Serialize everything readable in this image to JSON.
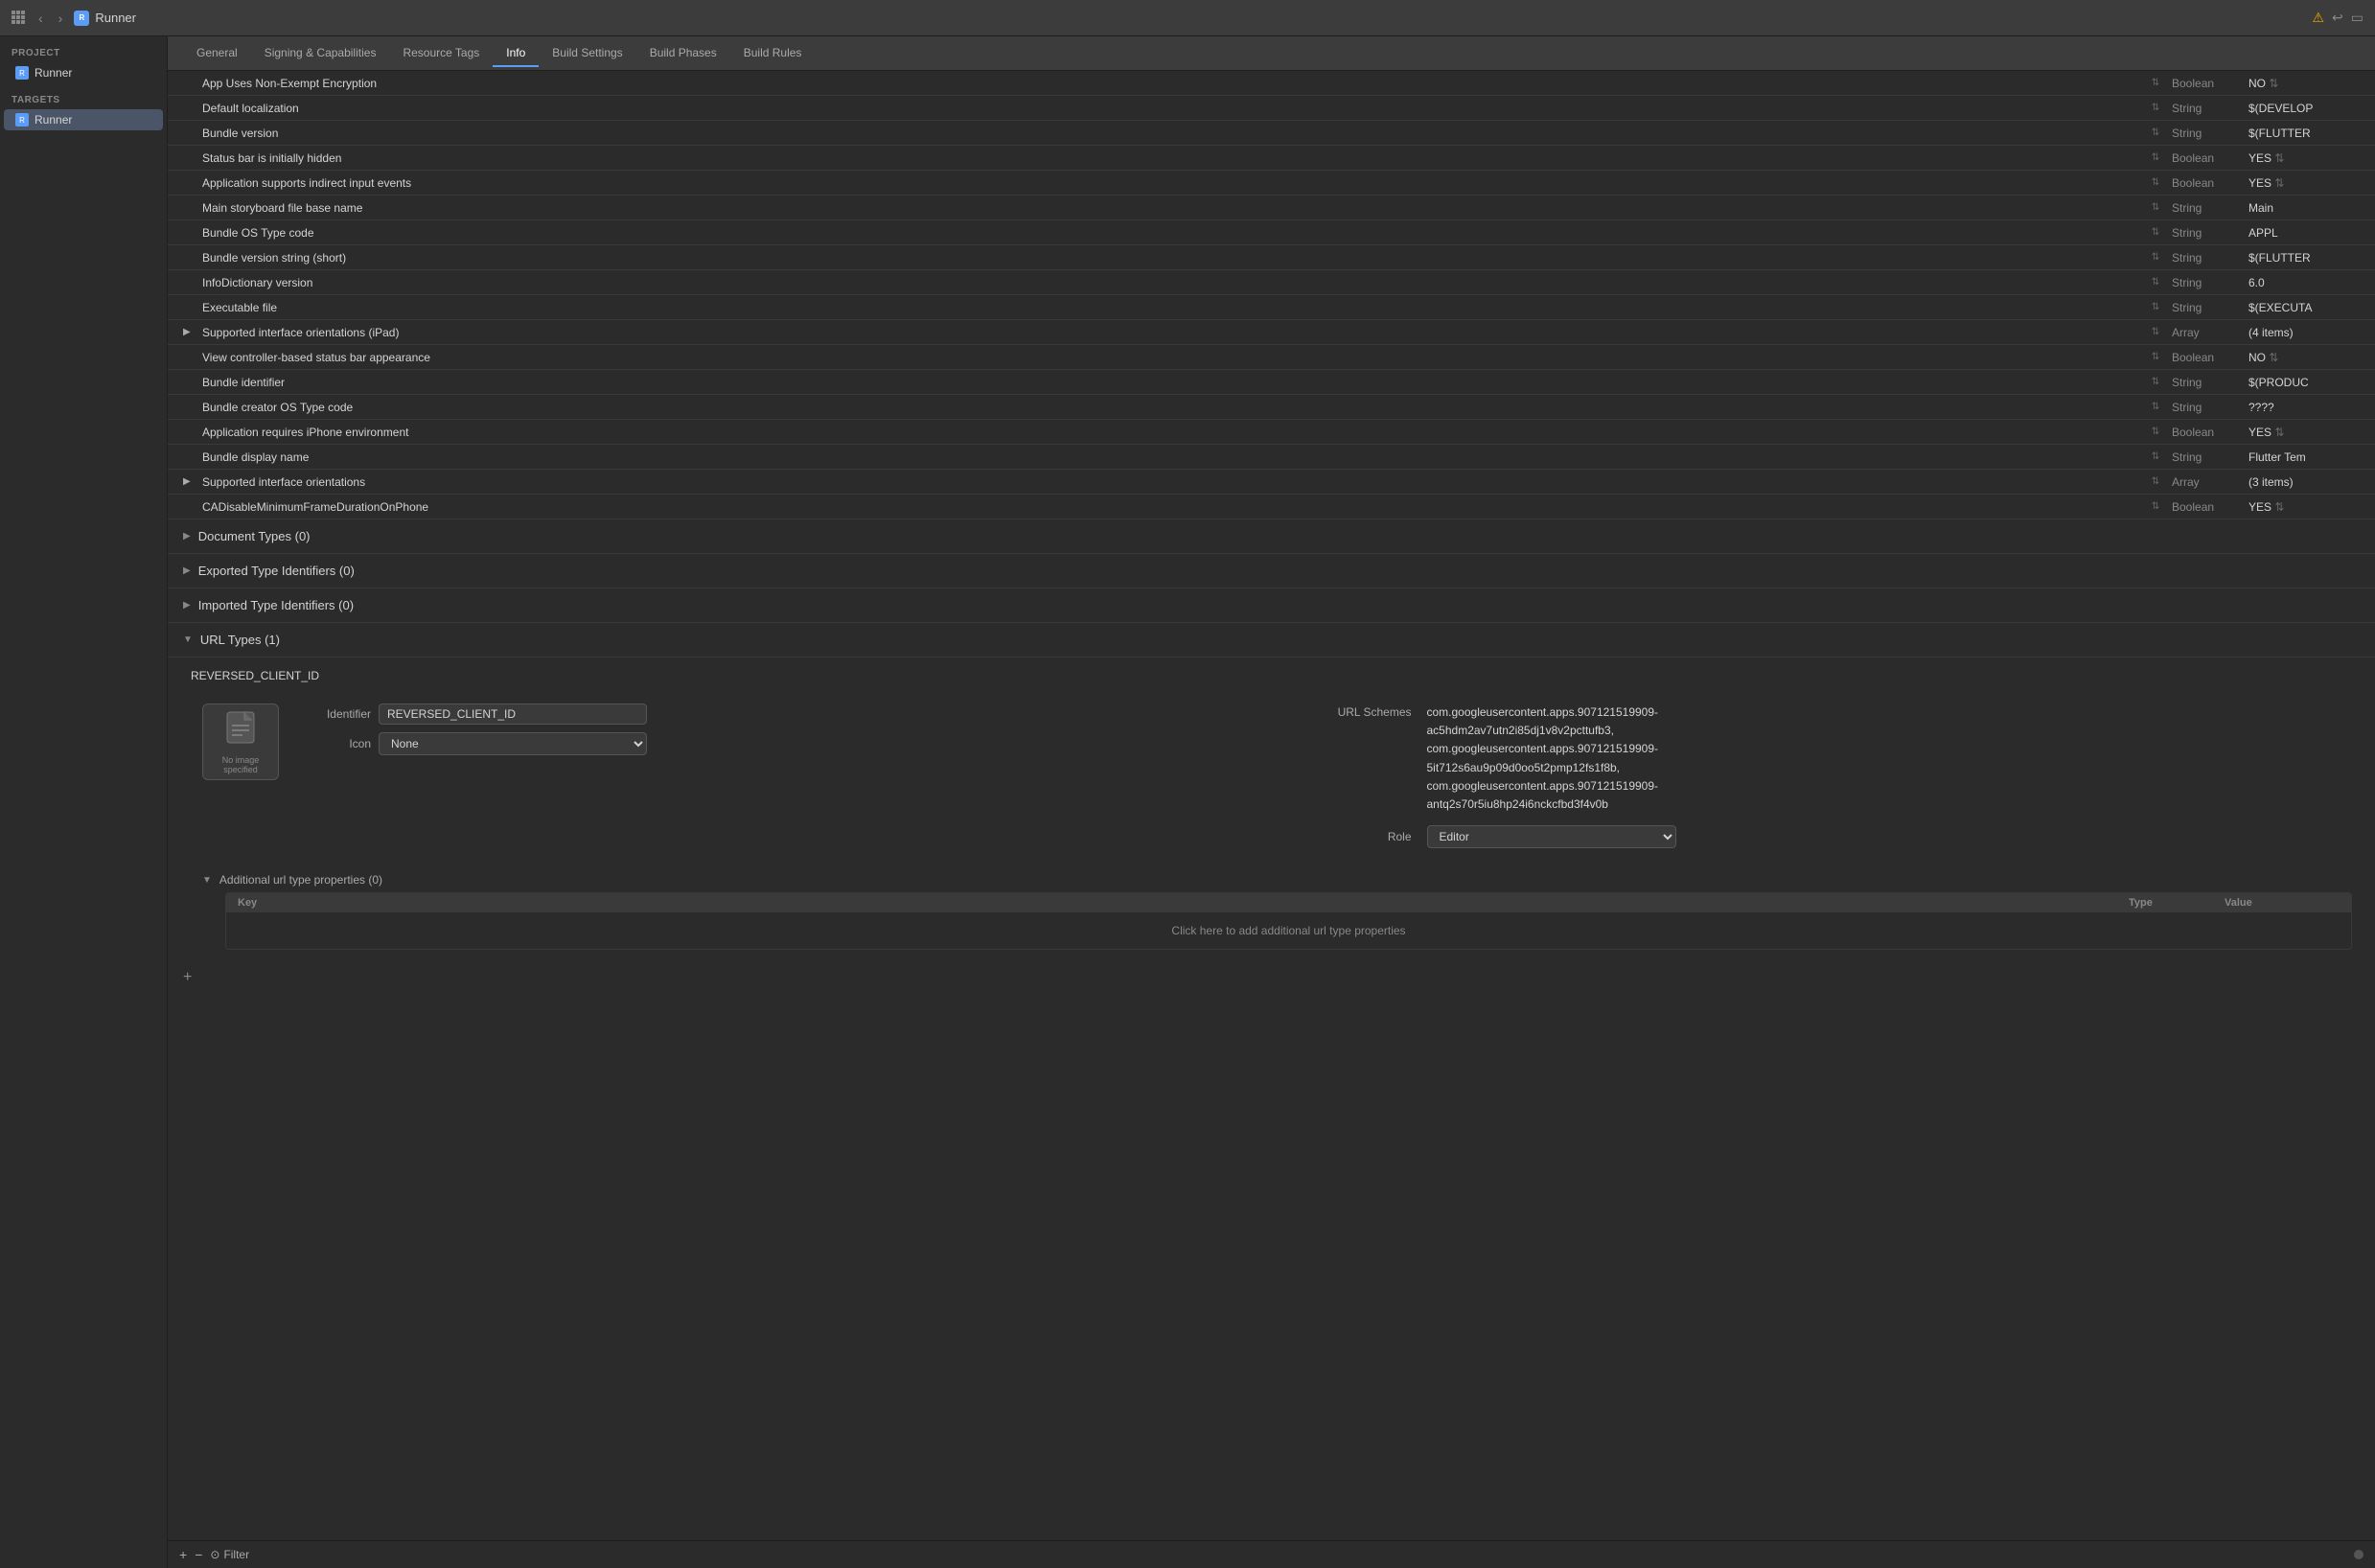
{
  "titleBar": {
    "appName": "Runner",
    "navBack": "‹",
    "navForward": "›"
  },
  "tabs": [
    {
      "label": "General",
      "active": false
    },
    {
      "label": "Signing & Capabilities",
      "active": false
    },
    {
      "label": "Resource Tags",
      "active": false
    },
    {
      "label": "Info",
      "active": true
    },
    {
      "label": "Build Settings",
      "active": false
    },
    {
      "label": "Build Phases",
      "active": false
    },
    {
      "label": "Build Rules",
      "active": false
    }
  ],
  "sidebar": {
    "projectLabel": "PROJECT",
    "projectItem": "Runner",
    "targetsLabel": "TARGETS",
    "targetItem": "Runner"
  },
  "properties": [
    {
      "key": "App Uses Non-Exempt Encryption",
      "type": "Boolean",
      "value": "NO",
      "indent": 0,
      "stepper": true
    },
    {
      "key": "Default localization",
      "type": "String",
      "value": "$(DEVELOP",
      "indent": 0,
      "stepper": true
    },
    {
      "key": "Bundle version",
      "type": "String",
      "value": "$(FLUTTER",
      "indent": 0,
      "stepper": true
    },
    {
      "key": "Status bar is initially hidden",
      "type": "Boolean",
      "value": "YES",
      "indent": 0,
      "stepper": true
    },
    {
      "key": "Application supports indirect input events",
      "type": "Boolean",
      "value": "YES",
      "indent": 0,
      "stepper": true
    },
    {
      "key": "Main storyboard file base name",
      "type": "String",
      "value": "Main",
      "indent": 0,
      "stepper": true
    },
    {
      "key": "Bundle OS Type code",
      "type": "String",
      "value": "APPL",
      "indent": 0,
      "stepper": true
    },
    {
      "key": "Bundle version string (short)",
      "type": "String",
      "value": "$(FLUTTER",
      "indent": 0,
      "stepper": true
    },
    {
      "key": "InfoDictionary version",
      "type": "String",
      "value": "6.0",
      "indent": 0,
      "stepper": true
    },
    {
      "key": "Executable file",
      "type": "String",
      "value": "$(EXECUTA",
      "indent": 0,
      "stepper": true
    },
    {
      "key": "Supported interface orientations (iPad)",
      "type": "Array",
      "value": "(4 items)",
      "indent": 0,
      "stepper": true,
      "expandable": true
    },
    {
      "key": "View controller-based status bar appearance",
      "type": "Boolean",
      "value": "NO",
      "indent": 0,
      "stepper": true
    },
    {
      "key": "Bundle identifier",
      "type": "String",
      "value": "$(PRODUC",
      "indent": 0,
      "stepper": true
    },
    {
      "key": "Bundle creator OS Type code",
      "type": "String",
      "value": "????",
      "indent": 0,
      "stepper": true
    },
    {
      "key": "Application requires iPhone environment",
      "type": "Boolean",
      "value": "YES",
      "indent": 0,
      "stepper": true
    },
    {
      "key": "Bundle display name",
      "type": "String",
      "value": "Flutter Tem",
      "indent": 0,
      "stepper": true
    },
    {
      "key": "Supported interface orientations",
      "type": "Array",
      "value": "(3 items)",
      "indent": 0,
      "stepper": true,
      "expandable": true
    },
    {
      "key": "CADisableMinimumFrameDurationOnPhone",
      "type": "Boolean",
      "value": "YES",
      "indent": 0,
      "stepper": true
    }
  ],
  "sections": {
    "documentTypes": {
      "label": "Document Types (0)",
      "expanded": false
    },
    "exportedTypeIdentifiers": {
      "label": "Exported Type Identifiers (0)",
      "expanded": false
    },
    "importedTypeIdentifiers": {
      "label": "Imported Type Identifiers (0)",
      "expanded": false
    },
    "urlTypes": {
      "label": "URL Types (1)",
      "expanded": true
    }
  },
  "urlTypes": {
    "entryTitle": "REVERSED_CLIENT_ID",
    "iconPlaceholder": "No image specified",
    "identifierLabel": "Identifier",
    "identifierValue": "REVERSED_CLIENT_ID",
    "iconLabel": "Icon",
    "iconValue": "None",
    "urlSchemesLabel": "URL Schemes",
    "urlSchemesValue": "com.googleusercontent.apps.907121519909-ac5hdm2av7utn2i85dj1v8v2pcttufb3, com.googleusercontent.apps.907121519909-5it712s6au9p09d0oo5t2pmp12fs1f8b, com.googleusercontent.apps.907121519909-antq2s70r5iu8hp24i6nckcfbd3f4v0b",
    "roleLabel": "Role",
    "roleValue": "Editor",
    "additionalLabel": "Additional url type properties (0)",
    "tableHeaders": {
      "key": "Key",
      "type": "Type",
      "value": "Value"
    },
    "emptyMessage": "Click here to add additional url type properties"
  },
  "bottomBar": {
    "addLabel": "+",
    "removeLabel": "−",
    "filterLabel": "Filter"
  }
}
